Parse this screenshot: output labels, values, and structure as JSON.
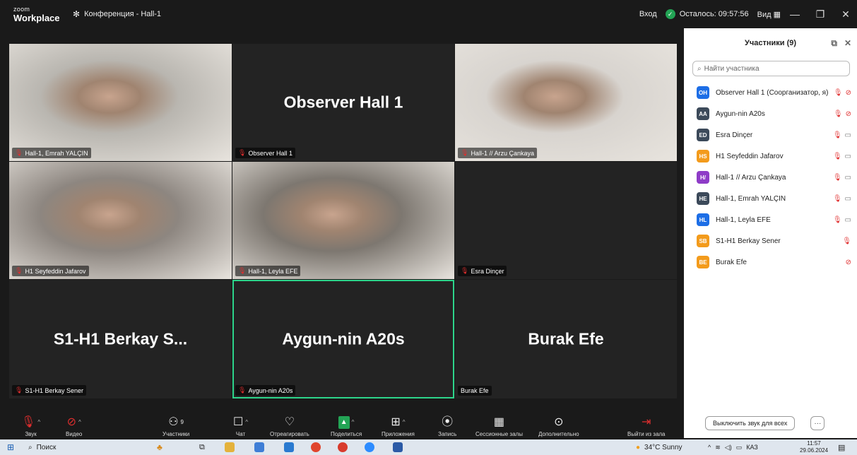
{
  "app": {
    "brand_top": "zoom",
    "brand_bottom": "Workplace",
    "meeting_title": "Конференция - Hall-1",
    "login": "Вход",
    "time_left": "Осталось: 09:57:56",
    "view": "Вид"
  },
  "tiles": [
    {
      "big": "",
      "tag": "Hall-1, Emrah YALÇIN",
      "cam": "#b9b6b0"
    },
    {
      "big": "Observer Hall 1",
      "tag": "Observer Hall 1",
      "cam": ""
    },
    {
      "big": "",
      "tag": "Hall-1 // Arzu Çankaya",
      "cam": "#d8d4cf"
    },
    {
      "big": "",
      "tag": "H1 Seyfeddin Jafarov",
      "cam": "#8d8680"
    },
    {
      "big": "",
      "tag": "Hall-1, Leyla EFE",
      "cam": "#7d7770"
    },
    {
      "big": "",
      "tag": "Esra Dinçer",
      "cam": ""
    },
    {
      "big": "S1-H1 Berkay S...",
      "tag": "S1-H1 Berkay Sener",
      "cam": ""
    },
    {
      "big": "Aygun-nin A20s",
      "tag": "Aygun-nin A20s",
      "cam": ""
    },
    {
      "big": "Burak Efe",
      "tag": "Burak Efe",
      "cam": ""
    }
  ],
  "panel": {
    "title": "Участники (9)",
    "search_placeholder": "Найти участника",
    "participants": [
      {
        "initials": "OH",
        "name": "Observer Hall 1 (Соорганизатор, я)",
        "color": "#1d6ee6",
        "mic": "muted",
        "video": "off"
      },
      {
        "initials": "AA",
        "name": "Aygun-nin A20s",
        "color": "#3c4a5a",
        "mic": "muted",
        "video": "off"
      },
      {
        "initials": "ED",
        "name": "Esra Dinçer",
        "color": "#3c4a5a",
        "mic": "muted",
        "video": "on"
      },
      {
        "initials": "HS",
        "name": "H1 Seyfeddin Jafarov",
        "color": "#f39b1c",
        "mic": "muted",
        "video": "on"
      },
      {
        "initials": "H/",
        "name": "Hall-1 // Arzu Çankaya",
        "color": "#8e3cc7",
        "mic": "muted",
        "video": "on"
      },
      {
        "initials": "HE",
        "name": "Hall-1, Emrah YALÇIN",
        "color": "#3c4a5a",
        "mic": "muted",
        "video": "on"
      },
      {
        "initials": "HL",
        "name": "Hall-1, Leyla EFE",
        "color": "#1d6ee6",
        "mic": "muted",
        "video": "on"
      },
      {
        "initials": "SB",
        "name": "S1-H1 Berkay Sener",
        "color": "#f39b1c",
        "mic": "muted",
        "video": ""
      },
      {
        "initials": "BE",
        "name": "Burak Efe",
        "color": "#f39b1c",
        "mic": "",
        "video": "off"
      }
    ],
    "mute_all": "Выключить звук для всех",
    "more": "···"
  },
  "toolbar": {
    "sound": "Звук",
    "video": "Видео",
    "participants": "Участники",
    "participants_count": "9",
    "chat": "Чат",
    "react": "Отреагировать",
    "share": "Поделиться",
    "apps": "Приложения",
    "record": "Запись",
    "breakout": "Сессионные залы",
    "more": "Дополнительно",
    "leave": "Выйти из зала"
  },
  "taskbar": {
    "search": "Поиск",
    "weather": "34°C  Sunny",
    "lang": "КАЗ",
    "time": "11:57",
    "date": "29.06.2024"
  }
}
